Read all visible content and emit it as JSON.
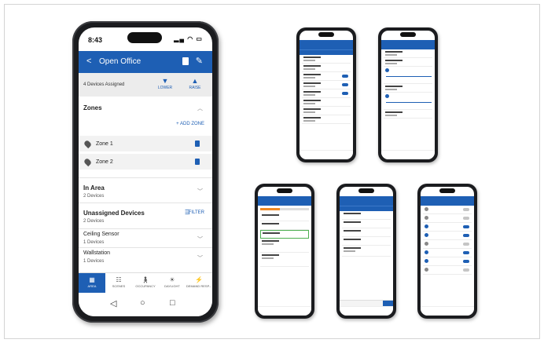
{
  "main_phone": {
    "status": {
      "time": "8:43"
    },
    "header": {
      "title": "Open Office"
    },
    "assigned": {
      "count_text": "4 Devices Assigned",
      "lower_label": "LOWER",
      "raise_label": "RAISE"
    },
    "zones": {
      "title": "Zones",
      "add_label": "+ ADD ZONE",
      "items": [
        {
          "label": "Zone 1"
        },
        {
          "label": "Zone 2"
        }
      ]
    },
    "in_area": {
      "title": "In Area",
      "subtitle": "2 Devices"
    },
    "unassigned": {
      "title": "Unassigned Devices",
      "subtitle": "2 Devices",
      "filter_label": "FILTER",
      "devices": [
        {
          "name": "Ceiling Sensor",
          "count": "1 Devices"
        },
        {
          "name": "Wallstation",
          "count": "1 Devices"
        }
      ]
    },
    "bottom_nav": [
      {
        "label": "AREA",
        "icon": "area-icon"
      },
      {
        "label": "SCENES",
        "icon": "scenes-icon"
      },
      {
        "label": "OCCUPANCY",
        "icon": "occupancy-icon"
      },
      {
        "label": "DAYLIGHT",
        "icon": "daylight-icon"
      },
      {
        "label": "DEMAND RESP...",
        "icon": "demand-response-icon"
      }
    ]
  },
  "colors": {
    "brand": "#1e5fb4",
    "header_bg": "#1e5fb4",
    "panel_bg": "#ececec"
  }
}
